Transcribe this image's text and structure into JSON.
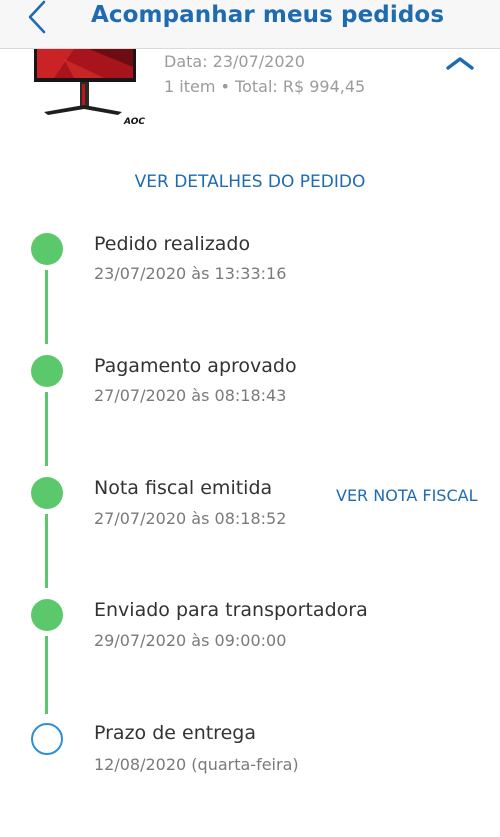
{
  "header": {
    "title": "Acompanhar meus pedidos",
    "back_icon": "chevron-left-icon"
  },
  "order": {
    "date": "Data: 23/07/2020",
    "summary": "1 item • Total: R$ 994,45",
    "product_brand": "AOC",
    "collapse_icon": "chevron-up-icon",
    "details_link": "VER DETALHES DO PEDIDO"
  },
  "timeline": {
    "steps": [
      {
        "title": "Pedido realizado",
        "time": "23/07/2020 às 13:33:16",
        "status": "done"
      },
      {
        "title": "Pagamento aprovado",
        "time": "27/07/2020 às 08:18:43",
        "status": "done"
      },
      {
        "title": "Nota fiscal emitida",
        "time": "27/07/2020 às 08:18:52",
        "status": "done",
        "action": "VER NOTA FISCAL"
      },
      {
        "title": "Enviado para transportadora",
        "time": "29/07/2020 às 09:00:00",
        "status": "done"
      },
      {
        "title": "Prazo de entrega",
        "time": "12/08/2020 (quarta-feira)",
        "status": "pending"
      }
    ]
  },
  "colors": {
    "accent": "#1e6bb2",
    "done": "#5bc96b",
    "pending": "#2a8fdc"
  }
}
